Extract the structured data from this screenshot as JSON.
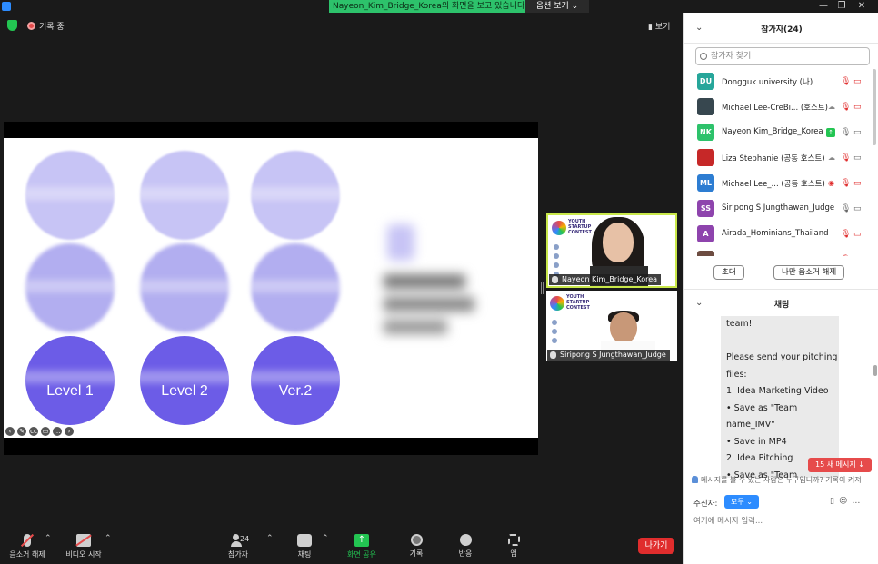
{
  "window": {
    "share_banner": "Nayeon_Kim_Bridge_Korea의 화면을 보고 있습니다",
    "view_options": "옵션 보기 ⌄",
    "minimize": "—",
    "restore": "❐",
    "close": "✕"
  },
  "meeting": {
    "recording_label": "기록 중",
    "view_label": "보기"
  },
  "slide": {
    "levels": [
      "Level 1",
      "Level 2",
      "Ver.2"
    ]
  },
  "tiles": [
    {
      "name": "Nayeon Kim_Bridge_Korea"
    },
    {
      "name": "Siripong S Jungthawan_Judge"
    }
  ],
  "poster": {
    "words": "YOUTH\nSTARTUP\nCONTEST"
  },
  "toolbar": {
    "unmute": "음소거 해제",
    "start_video": "비디오 시작",
    "participants": "참가자",
    "participants_count": "24",
    "chat": "채팅",
    "share_screen": "화면 공유",
    "record": "기록",
    "reactions": "반응",
    "apps": "앱",
    "leave": "나가기"
  },
  "panel": {
    "participants_title": "참가자(24)",
    "search_placeholder": "참가자 찾기",
    "participants": [
      {
        "initials": "DU",
        "color": "#26a69a",
        "name": "Dongguk university (나)",
        "icons": [
          "mic-off",
          "cam-off"
        ]
      },
      {
        "initials": "",
        "color": "#37474f",
        "name": "Michael Lee-CreBi... (호스트)",
        "icons": [
          "cloud",
          "mic-off",
          "cam-off"
        ]
      },
      {
        "initials": "NK",
        "color": "#2dc26b",
        "name": "Nayeon Kim_Bridge_Korea",
        "icons": [
          "share",
          "mic",
          "cam"
        ]
      },
      {
        "initials": "",
        "color": "#c62828",
        "name": "Liza Stephanie (공동 호스트)",
        "icons": [
          "cloud",
          "mic-off",
          "cam"
        ]
      },
      {
        "initials": "ML",
        "color": "#2d7dd2",
        "name": "Michael Lee_... (공동 호스트)",
        "icons": [
          "rec",
          "mic-off",
          "cam-off"
        ]
      },
      {
        "initials": "SS",
        "color": "#8e44ad",
        "name": "Siripong S Jungthawan_Judge",
        "icons": [
          "mic",
          "cam"
        ]
      },
      {
        "initials": "A",
        "color": "#8e44ad",
        "name": "Airada_Hominians_Thailand",
        "icons": [
          "mic-off",
          "cam-off"
        ]
      },
      {
        "initials": "",
        "color": "#6d4c41",
        "name": "",
        "icons": [
          "mic-off",
          "cam-off"
        ]
      }
    ],
    "invite_button": "초대",
    "unmute_me_button": "나만 음소거 해제",
    "chat_title": "채팅",
    "chat_lines": [
      "team!",
      "",
      "Please send your pitching",
      "files:",
      "1. Idea Marketing Video",
      "• Save as \"Team",
      "name_IMV\"",
      "• Save in MP4",
      "2. Idea Pitching",
      "• Save as \"Team"
    ],
    "new_messages": "15 새 메시지 ↓",
    "who_can_see": "메시지를 볼 수 있는 사람은 누구입니까? 기록이 켜져",
    "recipient_label": "수신자:",
    "recipient_value": "모두 ⌄",
    "chat_placeholder": "여기에 메시지 입력..."
  },
  "colors": {
    "accent_green": "#2dc26b",
    "slide_purple": "#6c5ce7",
    "leave_red": "#e02d2d",
    "link_blue": "#2d8cff"
  }
}
